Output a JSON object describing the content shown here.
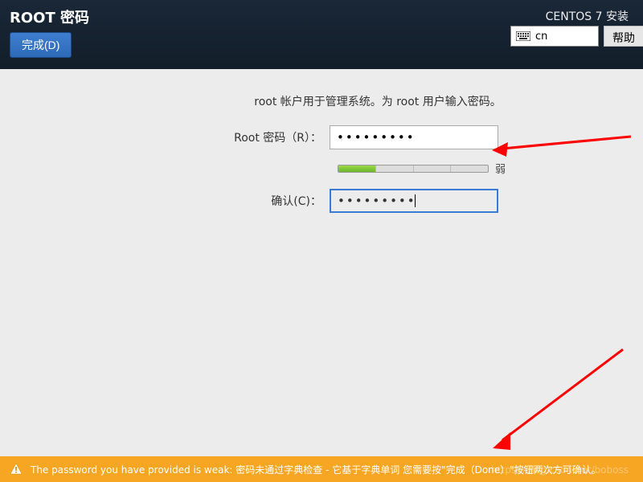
{
  "header": {
    "title": "ROOT 密码",
    "done_label": "完成(D)",
    "distro": "CENTOS 7 安装",
    "keyboard_layout": "cn",
    "help_label": "帮助"
  },
  "form": {
    "intro": "root 帐户用于管理系统。为 root 用户输入密码。",
    "password_label": "Root 密码（R）：",
    "password_value": "•••••••••",
    "confirm_label": "确认(C)：",
    "confirm_value": "•••••••••",
    "strength_label": "弱",
    "strength_level": 1,
    "strength_total": 4
  },
  "warning": {
    "message": "The password you have provided is weak: 密码未通过字典检查 - 它基于字典单词 您需要按\"完成（Done）\"按钮两次方可确认。"
  },
  "watermark": "https://blog.csdn.net/boboss"
}
